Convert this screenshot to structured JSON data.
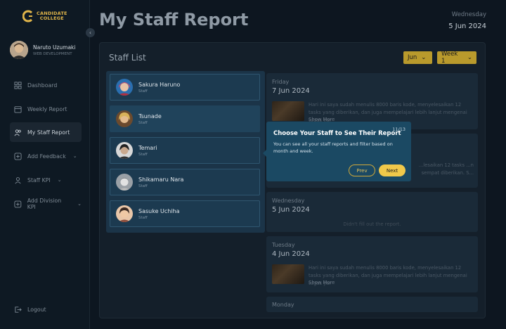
{
  "brand": {
    "line1": "CANDIDATE",
    "line2": "COLLEGE"
  },
  "user": {
    "name": "Naruto Uzumaki",
    "role": "WEB DEVELOPMENT"
  },
  "nav": [
    {
      "label": "Dashboard",
      "icon": "grid-icon"
    },
    {
      "label": "Weekly Report",
      "icon": "calendar-icon"
    },
    {
      "label": "My Staff Report",
      "icon": "users-icon"
    },
    {
      "label": "Add Feedback",
      "icon": "plus-square-icon"
    },
    {
      "label": "Staff KPI",
      "icon": "user-icon"
    },
    {
      "label": "Add Division KPI",
      "icon": "plus-square-icon"
    }
  ],
  "logout": "Logout",
  "page": {
    "title": "My Staff Report",
    "day": "Wednesday",
    "date": "5 Jun 2024"
  },
  "panel": {
    "title": "Staff List",
    "month_filter": "Jun",
    "week_filter": "Week 1"
  },
  "staff": [
    {
      "name": "Sakura Haruno",
      "role": "Staff"
    },
    {
      "name": "Tsunade",
      "role": "Staff"
    },
    {
      "name": "Temari",
      "role": "Staff"
    },
    {
      "name": "Shikamaru Nara",
      "role": "Staff"
    },
    {
      "name": "Sasuke Uchiha",
      "role": "Staff"
    }
  ],
  "reports": [
    {
      "day": "Friday",
      "date": "7 Jun 2024",
      "text": "Hari ini saya sudah menulis 8000 baris kode, menyelesaikan 12 tasks yang diberikan, dan juga mempelajari lebih lanjut mengenai tugas yar",
      "more": "Show More"
    },
    {
      "day": "",
      "date": "",
      "text": "...lesaikan 12 tasks ...n sempat diberikan. S...",
      "more": ""
    },
    {
      "day": "Wednesday",
      "date": "5 Jun 2024",
      "empty": "Didn't fill out the report."
    },
    {
      "day": "Tuesday",
      "date": "4 Jun 2024",
      "text": "Hari ini saya sudah menulis 8000 baris kode, menyelesaikan 12 tasks yang diberikan, dan juga mempelajari lebih lanjut mengenai tugas yar",
      "more": "Show More"
    },
    {
      "day": "Monday"
    }
  ],
  "tour": {
    "title": "Choose Your Staff to See Their Report",
    "step": "11/13",
    "body": "You can see all your staff reports and filter based on month and week.",
    "prev": "Prev",
    "next": "Next"
  }
}
